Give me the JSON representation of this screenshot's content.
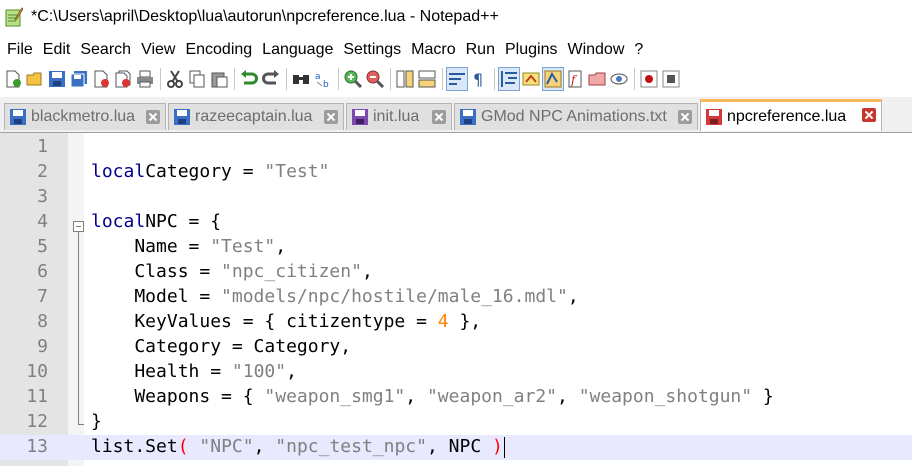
{
  "window": {
    "title": "*C:\\Users\\april\\Desktop\\lua\\autorun\\npcreference.lua - Notepad++"
  },
  "menu": [
    "File",
    "Edit",
    "Search",
    "View",
    "Encoding",
    "Language",
    "Settings",
    "Macro",
    "Run",
    "Plugins",
    "Window",
    "?"
  ],
  "toolbar": {
    "icons": [
      "new-icon",
      "open-icon",
      "save-icon",
      "save-all-icon",
      "close-icon",
      "close-all-icon",
      "print-icon",
      "cut-icon",
      "copy-icon",
      "paste-icon",
      "undo-icon",
      "redo-icon",
      "find-icon",
      "replace-icon",
      "zoom-in-icon",
      "zoom-out-icon",
      "sync-vertical-icon",
      "sync-horizontal-icon",
      "word-wrap-icon",
      "show-all-chars-icon",
      "indent-guide-icon",
      "lang-udl-icon",
      "doc-map-icon",
      "function-list-icon",
      "folder-workspace-icon",
      "monitoring-icon",
      "record-macro-icon",
      "stop-record-icon"
    ]
  },
  "tabs": [
    {
      "label": "blackmetro.lua",
      "active": false,
      "unsaved": false
    },
    {
      "label": "razeecaptain.lua",
      "active": false,
      "unsaved": false
    },
    {
      "label": "init.lua",
      "active": false,
      "unsaved": false
    },
    {
      "label": "GMod NPC Animations.txt",
      "active": false,
      "unsaved": false
    },
    {
      "label": "npcreference.lua",
      "active": true,
      "unsaved": true
    }
  ],
  "editor": {
    "line_numbers": [
      "1",
      "2",
      "3",
      "4",
      "5",
      "6",
      "7",
      "8",
      "9",
      "10",
      "11",
      "12",
      "13"
    ],
    "current_line": 13,
    "lines": [
      [],
      [
        [
          "kw",
          "local"
        ],
        [
          "",
          "Category = "
        ],
        [
          "str",
          "\"Test\""
        ]
      ],
      [],
      [
        [
          "kw",
          "local"
        ],
        [
          "",
          "NPC = {"
        ]
      ],
      [
        [
          "",
          "    Name = "
        ],
        [
          "str",
          "\"Test\""
        ],
        [
          "",
          ","
        ]
      ],
      [
        [
          "",
          "    Class = "
        ],
        [
          "str",
          "\"npc_citizen\""
        ],
        [
          "",
          ","
        ]
      ],
      [
        [
          "",
          "    Model = "
        ],
        [
          "str",
          "\"models/npc/hostile/male_16.mdl\""
        ],
        [
          "",
          ","
        ]
      ],
      [
        [
          "",
          "    KeyValues = { citizentype = "
        ],
        [
          "num",
          "4"
        ],
        [
          "",
          " },"
        ]
      ],
      [
        [
          "",
          "    Category = Category,"
        ]
      ],
      [
        [
          "",
          "    Health = "
        ],
        [
          "str",
          "\"100\""
        ],
        [
          "",
          ","
        ]
      ],
      [
        [
          "",
          "    Weapons = { "
        ],
        [
          "str",
          "\"weapon_smg1\""
        ],
        [
          "",
          ", "
        ],
        [
          "str",
          "\"weapon_ar2\""
        ],
        [
          "",
          ", "
        ],
        [
          "str",
          "\"weapon_shotgun\""
        ],
        [
          "",
          " }"
        ]
      ],
      [
        [
          "",
          "}"
        ]
      ],
      [
        [
          "",
          "list.Set"
        ],
        [
          "paren",
          "("
        ],
        [
          "",
          " "
        ],
        [
          "str",
          "\"NPC\""
        ],
        [
          "",
          ", "
        ],
        [
          "str",
          "\"npc_test_npc\""
        ],
        [
          "",
          ", NPC "
        ],
        [
          "paren",
          ")"
        ]
      ]
    ]
  }
}
